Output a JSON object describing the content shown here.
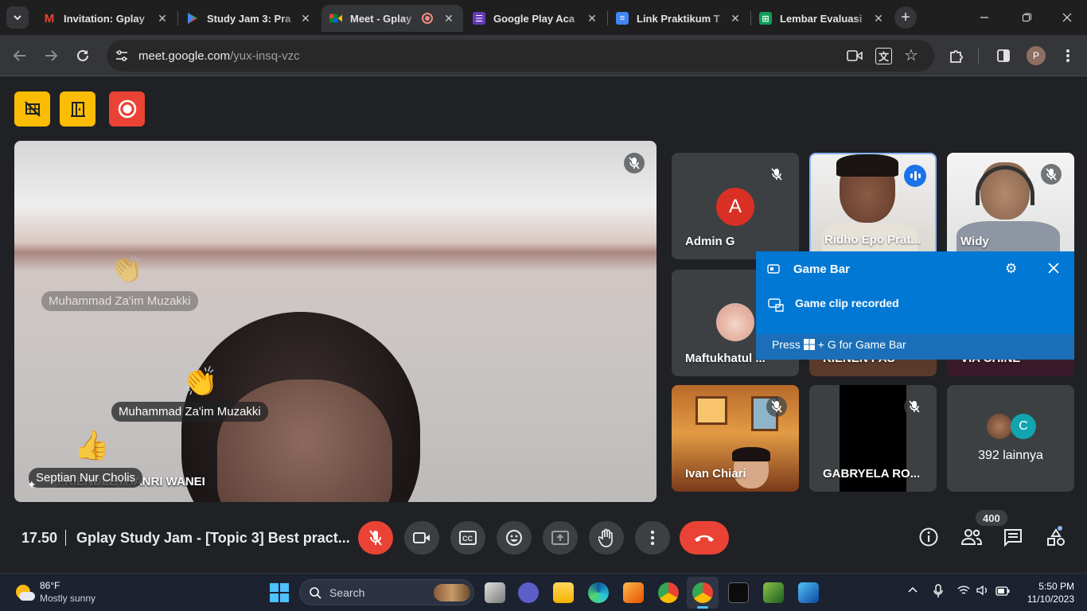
{
  "browser": {
    "tabs": [
      {
        "title": "Invitation: Gplay",
        "favicon": "gmail-icon",
        "color": "#ea4335"
      },
      {
        "title": "Study Jam 3: Pra",
        "favicon": "play-icon",
        "color": "#34a853"
      },
      {
        "title": "Meet - Gplay",
        "favicon": "meet-icon",
        "color": "#00832d",
        "active": true
      },
      {
        "title": "Google Play Aca",
        "favicon": "forms-icon",
        "color": "#673ab7"
      },
      {
        "title": "Link Praktikum T",
        "favicon": "docs-icon",
        "color": "#4285f4"
      },
      {
        "title": "Lembar Evaluasi",
        "favicon": "sheets-icon",
        "color": "#0f9d58"
      }
    ],
    "url_host": "meet.google.com",
    "url_path": "/yux-insq-vzc",
    "profile_initial": "P"
  },
  "meeting": {
    "main_participant": "FRIENDLEYHANRI WANEI",
    "reactions": [
      {
        "name": "Muhammad Za'im Muzakki",
        "emoji": "👏"
      },
      {
        "name": "Muhammad Za'im Muzakki",
        "emoji": "👏"
      },
      {
        "name": "Septian Nur Cholis",
        "emoji": "👍"
      }
    ],
    "tiles": [
      {
        "name": "Admin G",
        "avatar_letter": "A",
        "avatar_color": "#d93025"
      },
      {
        "name": "Ridho Epo Prat..."
      },
      {
        "name": "Widy"
      },
      {
        "name": "Maftukhatul ..."
      },
      {
        "name": "KIENEN PAS"
      },
      {
        "name": "VIA CHINE"
      },
      {
        "name": "Ivan Chiari"
      },
      {
        "name": "GABRYELA RO..."
      },
      {
        "name": "392 lainnya",
        "avatar_letter": "C"
      }
    ],
    "time": "17.50",
    "title": "Gplay Study Jam - [Topic 3] Best pract...",
    "participant_count": "400"
  },
  "gamebar": {
    "title": "Game Bar",
    "message": "Game clip recorded",
    "hint_pre": "Press",
    "hint_post": "+ G for Game Bar"
  },
  "taskbar": {
    "weather_temp": "86°F",
    "weather_desc": "Mostly sunny",
    "search_label": "Search",
    "time": "5:50 PM",
    "date": "11/10/2023"
  },
  "colors": {
    "accent_red": "#ea4335",
    "yellow_btn": "#fbbc04",
    "gamebar_blue": "#0078d4",
    "speaking_blue": "#8ab4f8"
  }
}
